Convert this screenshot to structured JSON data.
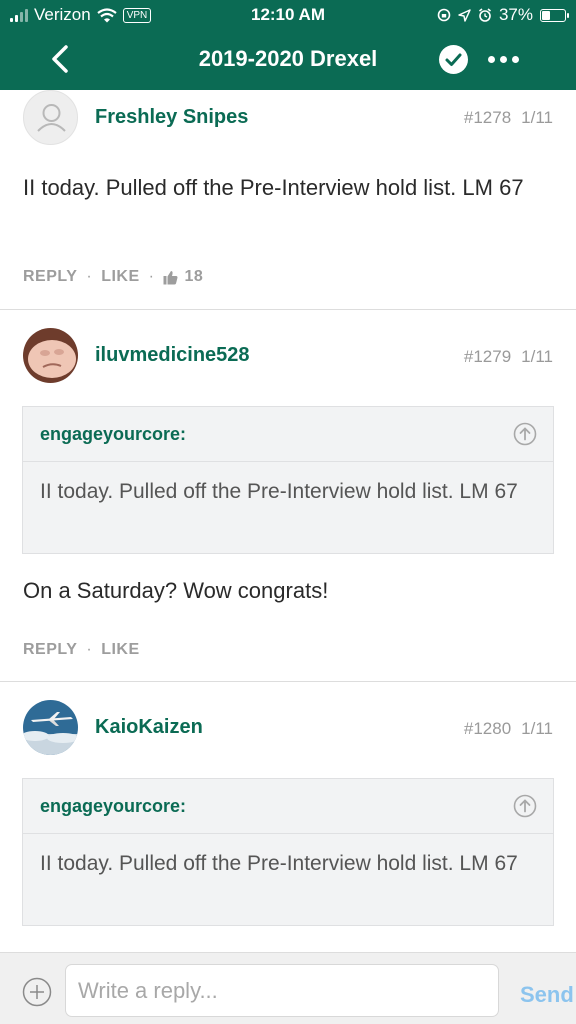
{
  "status_bar": {
    "carrier": "Verizon",
    "vpn": "VPN",
    "time": "12:10 AM",
    "battery": "37%",
    "battery_level": 0.37,
    "icons": [
      "signal-icon",
      "wifi-icon",
      "vpn-badge",
      "screen-lock-icon",
      "location-icon",
      "alarm-icon",
      "battery-icon"
    ]
  },
  "header": {
    "title": "2019-2020 Drexel",
    "background": "#0b6b54",
    "icons": [
      "back-chevron-icon",
      "checkmark-circle-icon",
      "more-dots-icon"
    ]
  },
  "posts": [
    {
      "author": "Freshley Snipes",
      "number": "#1278",
      "date": "1/11",
      "body": "II today. Pulled off the Pre-Interview hold list. LM 67",
      "reply_label": "REPLY",
      "like_label": "LIKE",
      "like_count": "18",
      "avatar": "default-user-icon"
    },
    {
      "author": "iluvmedicine528",
      "number": "#1279",
      "date": "1/11",
      "quote": {
        "author": "engageyourcore:",
        "text": "II today. Pulled off the Pre-Interview hold list. LM 67"
      },
      "body": "On a Saturday? Wow congrats!",
      "reply_label": "REPLY",
      "like_label": "LIKE",
      "avatar": "user-photo"
    },
    {
      "author": "KaioKaizen",
      "number": "#1280",
      "date": "1/11",
      "quote": {
        "author": "engageyourcore:",
        "text": "II today. Pulled off the Pre-Interview hold list. LM 67"
      },
      "avatar": "airplane-photo"
    }
  ],
  "reply_bar": {
    "placeholder": "Write a reply...",
    "send_label": "Send"
  },
  "colors": {
    "accent": "#0b6b54",
    "muted": "#9a9a9a",
    "send": "#8cc4ee"
  }
}
